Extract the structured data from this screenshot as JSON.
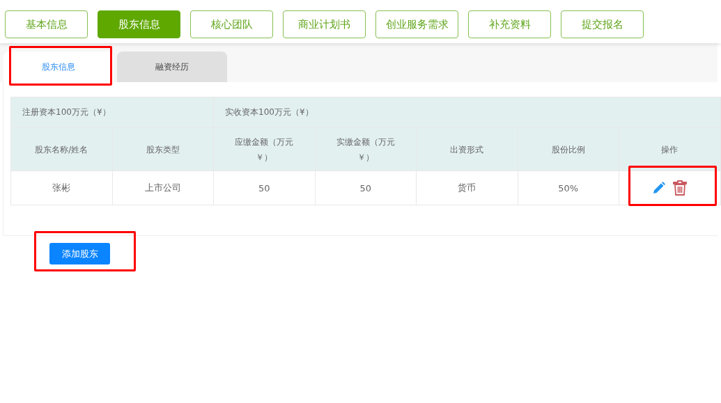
{
  "steps": [
    {
      "label": "基本信息",
      "selected": false
    },
    {
      "label": "股东信息",
      "selected": true
    },
    {
      "label": "核心团队",
      "selected": false
    },
    {
      "label": "商业计划书",
      "selected": false
    },
    {
      "label": "创业服务需求",
      "selected": false
    },
    {
      "label": "补充资料",
      "selected": false
    },
    {
      "label": "提交报名",
      "selected": false
    }
  ],
  "tabs": [
    {
      "label": "股东信息",
      "selected": true,
      "highlighted": true
    },
    {
      "label": "融资经历",
      "selected": false,
      "highlighted": false
    }
  ],
  "capital": [
    "注册资本100万元（¥）",
    "实收资本100万元（¥）"
  ],
  "table": {
    "columns": [
      "股东名称/姓名",
      "股东类型",
      "应缴金额（万元￥）",
      "实缴金额（万元￥）",
      "出资形式",
      "股份比例",
      "操作"
    ],
    "rows": [
      {
        "cells": [
          "张彬",
          "上市公司",
          "50",
          "50",
          "货币",
          "50%"
        ],
        "actions_highlighted": true
      }
    ]
  },
  "add_button": {
    "label": "添加股东",
    "highlighted": true
  }
}
